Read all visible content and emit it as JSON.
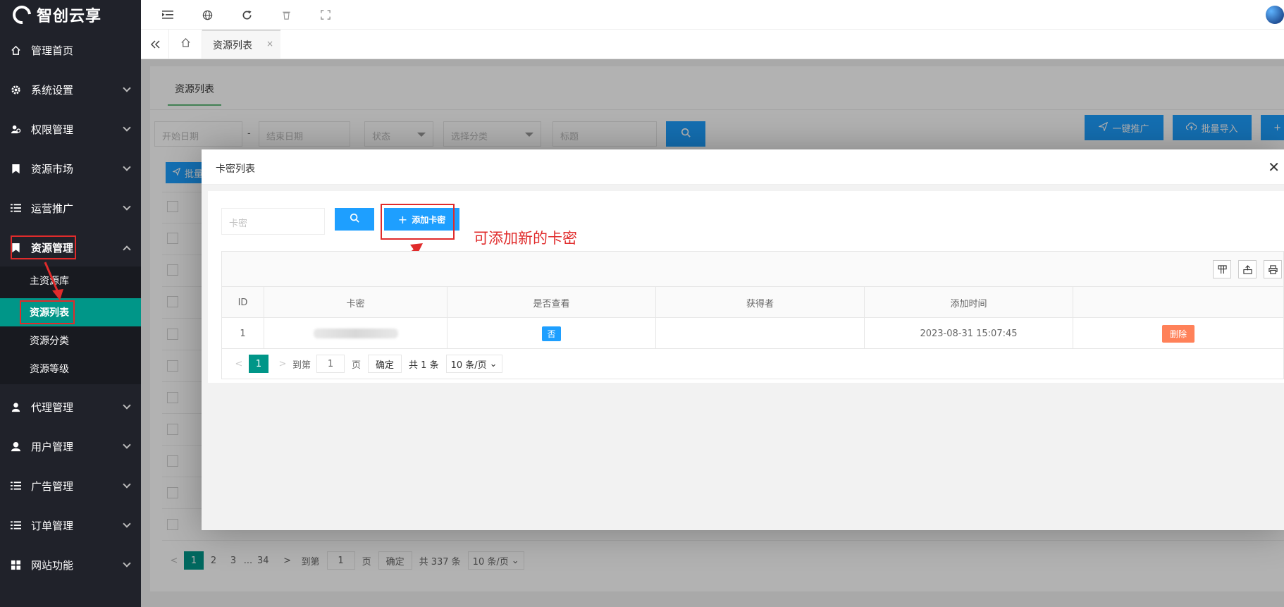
{
  "brand": {
    "name": "智创云享"
  },
  "sidebar": {
    "items": [
      {
        "label": "管理首页",
        "icon": "home-icon"
      },
      {
        "label": "系统设置",
        "icon": "gear-icon"
      },
      {
        "label": "权限管理",
        "icon": "users-icon"
      },
      {
        "label": "资源市场",
        "icon": "bookmark-icon"
      },
      {
        "label": "运营推广",
        "icon": "list-icon"
      },
      {
        "label": "资源管理",
        "icon": "bookmark-icon"
      },
      {
        "label": "代理管理",
        "icon": "agent-icon"
      },
      {
        "label": "用户管理",
        "icon": "user-icon"
      },
      {
        "label": "广告管理",
        "icon": "list-icon"
      },
      {
        "label": "订单管理",
        "icon": "list-icon"
      },
      {
        "label": "网站功能",
        "icon": "grid-icon"
      }
    ],
    "submenu": [
      {
        "label": "主资源库"
      },
      {
        "label": "资源列表"
      },
      {
        "label": "资源分类"
      },
      {
        "label": "资源等级"
      }
    ]
  },
  "tabs": {
    "current": "资源列表",
    "close": "×"
  },
  "page": {
    "tab": "资源列表",
    "filters": {
      "start_date": "开始日期",
      "dash": "-",
      "end_date": "结束日期",
      "status": "状态",
      "category": "选择分类",
      "title": "标题"
    },
    "buttons": {
      "promote": "一键推广",
      "import": "批量导入",
      "add": "+",
      "batch": "批量"
    },
    "pager": {
      "pages": [
        "1",
        "2",
        "3",
        "...",
        "34"
      ],
      "goto": "到第",
      "page_value": "1",
      "page_unit": "页",
      "confirm": "确定",
      "total": "共 337 条",
      "per_page": "10 条/页"
    }
  },
  "modal": {
    "title": "卡密列表",
    "close": "✕",
    "search_placeholder": "卡密",
    "add_button": "添加卡密",
    "annotation": "可添加新的卡密",
    "columns": [
      "ID",
      "卡密",
      "是否查看",
      "获得者",
      "添加时间",
      ""
    ],
    "rows": [
      {
        "id": "1",
        "viewed": "否",
        "owner": "",
        "time": "2023-08-31 15:07:45",
        "action": "删除"
      }
    ],
    "pager": {
      "page": "1",
      "goto": "到第",
      "page_value": "1",
      "page_unit": "页",
      "confirm": "确定",
      "total": "共 1 条",
      "per_page": "10 条/页"
    }
  },
  "colors": {
    "sidebar_bg": "#20222a",
    "active_green": "#009688",
    "primary_blue": "#1E9FFF",
    "annotation_red": "#e02b2b"
  }
}
